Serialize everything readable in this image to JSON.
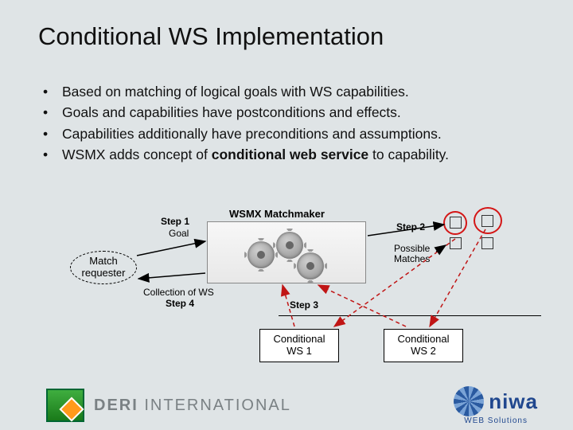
{
  "title": "Conditional WS Implementation",
  "bullets": [
    "Based on matching of logical goals with WS capabilities.",
    "Goals and capabilities have postconditions and effects.",
    "Capabilities additionally have preconditions and assumptions.",
    "WSMX adds concept of conditional web service to capability."
  ],
  "diagram": {
    "match_requester": "Match\nrequester",
    "step1": "Step 1",
    "goal": "Goal",
    "matchmaker": "WSMX Matchmaker",
    "step2": "Step 2",
    "possible": "Possible\nMatches",
    "step3": "Step 3",
    "step4": "Step 4",
    "collection": "Collection of WS",
    "cond1": "Conditional\nWS 1",
    "cond2": "Conditional\nWS 2"
  },
  "footer": {
    "deri": "DERI",
    "deri2": "INTERNATIONAL",
    "niwa": "niwa",
    "niwa_sub": "WEB Solutions"
  }
}
